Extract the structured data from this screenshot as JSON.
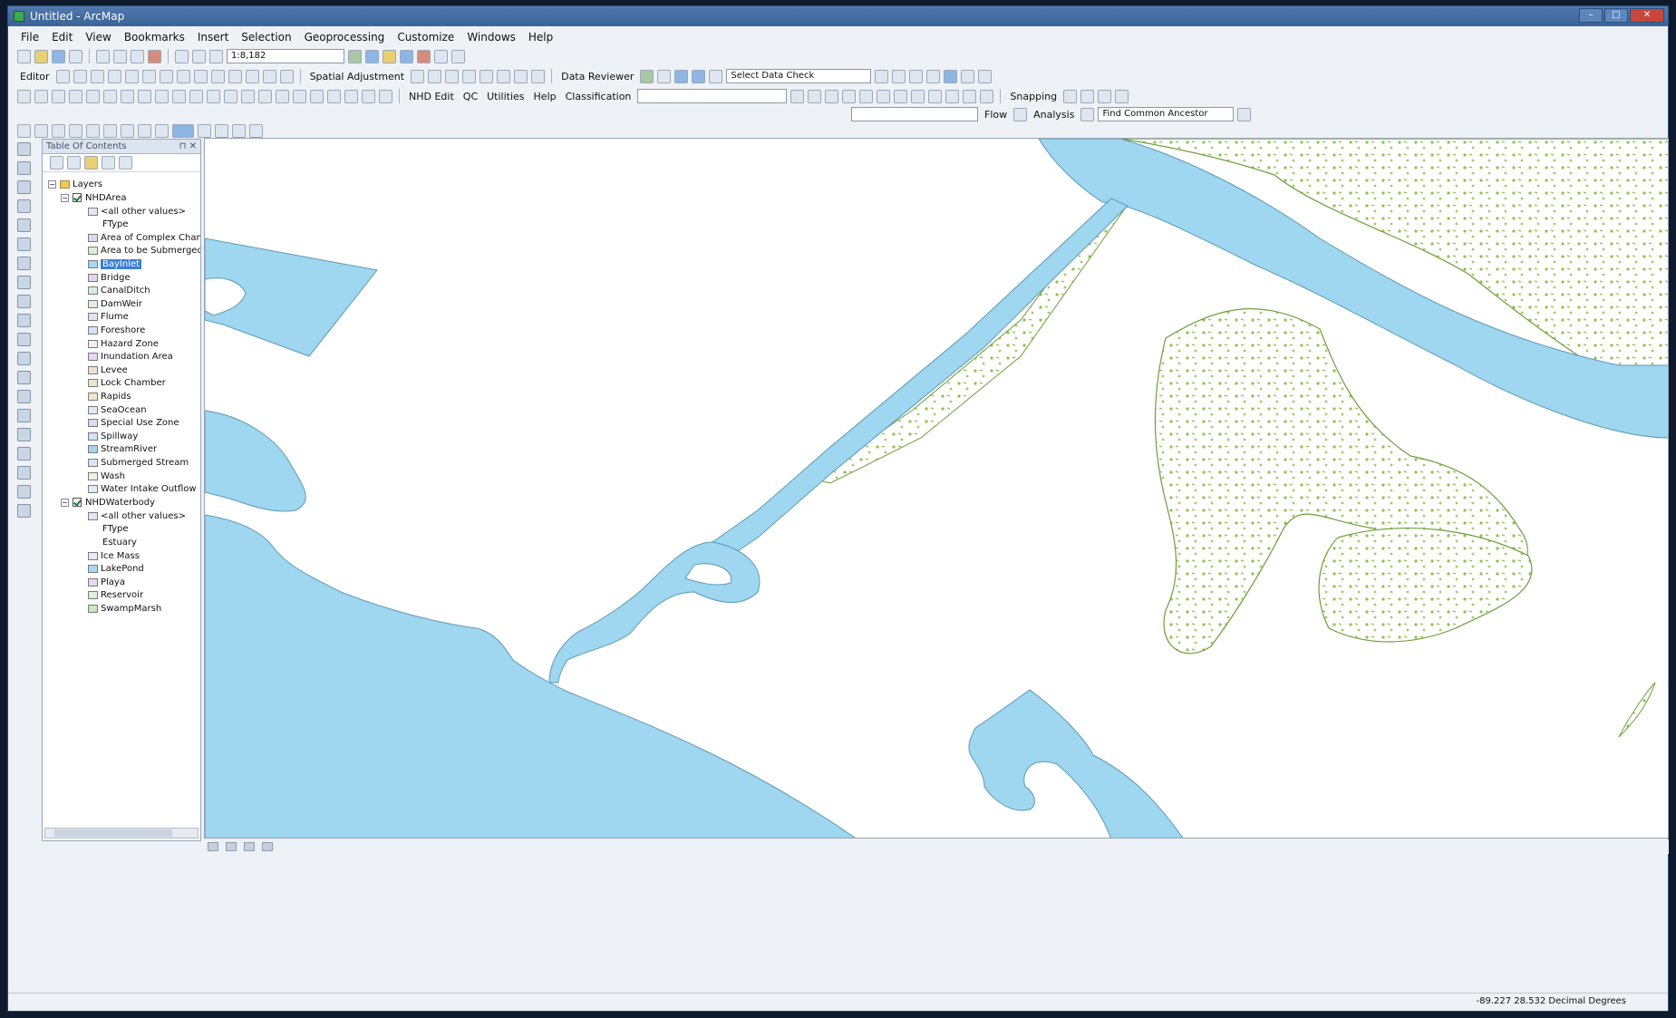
{
  "window": {
    "title": "Untitled - ArcMap"
  },
  "menu": [
    "File",
    "Edit",
    "View",
    "Bookmarks",
    "Insert",
    "Selection",
    "Geoprocessing",
    "Customize",
    "Windows",
    "Help"
  ],
  "toolbar": {
    "scale": "1:8,182",
    "editor": "Editor",
    "spatial_adjustment": "Spatial Adjustment",
    "data_reviewer": "Data Reviewer",
    "select_data_check": "Select Data Check",
    "nhd_edit": "NHD Edit",
    "qc": "QC",
    "utilities": "Utilities",
    "help": "Help",
    "classification": "Classification",
    "snapping": "Snapping",
    "flow": "Flow",
    "analysis": "Analysis",
    "find_common_ancestor": "Find Common Ancestor"
  },
  "toc": {
    "title": "Table Of Contents",
    "root": "Layers",
    "layers": [
      {
        "name": "NHDArea",
        "checked": true,
        "symbols": [
          {
            "label": "<all other values>",
            "color": "#e8e4f8"
          },
          {
            "label": "FType",
            "heading": true
          },
          {
            "label": "Area of Complex Channel",
            "color": "#e2d8f5"
          },
          {
            "label": "Area to be Submerged",
            "color": "#dbeed4"
          },
          {
            "label": "BayInlet",
            "color": "#a9d7f2",
            "selected": true
          },
          {
            "label": "Bridge",
            "color": "#e5d2ee"
          },
          {
            "label": "CanalDitch",
            "color": "#d4eedd"
          },
          {
            "label": "DamWeir",
            "color": "#dfeee0"
          },
          {
            "label": "Flume",
            "color": "#dce6f4"
          },
          {
            "label": "Foreshore",
            "color": "#d6e2f5"
          },
          {
            "label": "Hazard Zone",
            "color": "#f4eeee"
          },
          {
            "label": "Inundation Area",
            "color": "#e6d6f0"
          },
          {
            "label": "Levee",
            "color": "#f1e0d6"
          },
          {
            "label": "Lock Chamber",
            "color": "#ece8d0"
          },
          {
            "label": "Rapids",
            "color": "#efe6c8"
          },
          {
            "label": "SeaOcean",
            "color": "#dfe9f6"
          },
          {
            "label": "Special Use Zone",
            "color": "#e0d8f3"
          },
          {
            "label": "Spillway",
            "color": "#cfe2f7"
          },
          {
            "label": "StreamRiver",
            "color": "#a6d3f1"
          },
          {
            "label": "Submerged Stream",
            "color": "#d8e6f7"
          },
          {
            "label": "Wash",
            "color": "#eef3e2"
          },
          {
            "label": "Water Intake Outflow",
            "color": "#dfeef0"
          }
        ]
      },
      {
        "name": "NHDWaterbody",
        "checked": true,
        "symbols": [
          {
            "label": "<all other values>",
            "color": "#e8e4f8"
          },
          {
            "label": "FType",
            "heading": true
          },
          {
            "label": "Estuary",
            "heading": true
          },
          {
            "label": "Ice Mass",
            "color": "#e3ecf8"
          },
          {
            "label": "LakePond",
            "color": "#a9d7f2"
          },
          {
            "label": "Playa",
            "color": "#ead7f2"
          },
          {
            "label": "Reservoir",
            "color": "#e0f0dc"
          },
          {
            "label": "SwampMarsh",
            "color": "#c8e8bf"
          }
        ]
      }
    ]
  },
  "map": {
    "water_color": "#9fd7f0",
    "swamp_color": "#8bc34a"
  },
  "status": {
    "coordinates": "-89.227  28.532 Decimal Degrees"
  }
}
